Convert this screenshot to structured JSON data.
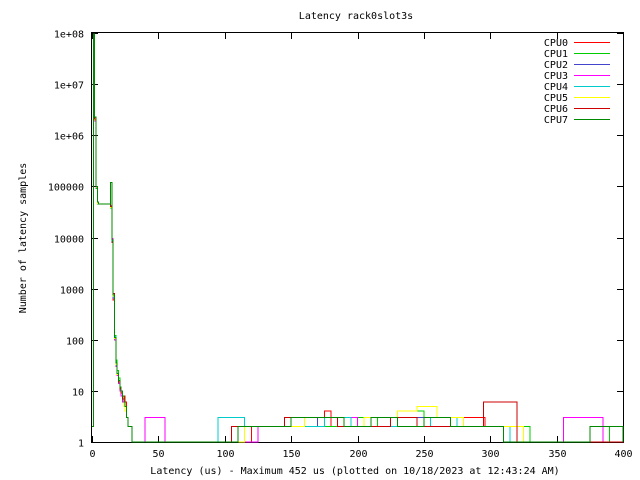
{
  "chart_data": {
    "type": "line",
    "title": "Latency rack0slot3s",
    "xlabel": "Latency (us) - Maximum 452 us (plotted on 10/18/2023 at 12:43:24 AM)",
    "ylabel": "Number of latency samples",
    "xlim": [
      0,
      400
    ],
    "ylim": [
      1,
      100000000
    ],
    "yscale": "log",
    "grid": false,
    "legend_position": "top-right",
    "x_ticks": [
      {
        "value": 0,
        "label": "0"
      },
      {
        "value": 50,
        "label": "50"
      },
      {
        "value": 100,
        "label": "100"
      },
      {
        "value": 150,
        "label": "150"
      },
      {
        "value": 200,
        "label": "200"
      },
      {
        "value": 250,
        "label": "250"
      },
      {
        "value": 300,
        "label": "300"
      },
      {
        "value": 350,
        "label": "350"
      },
      {
        "value": 400,
        "label": "400"
      }
    ],
    "y_ticks": [
      {
        "value": 1,
        "label": "1"
      },
      {
        "value": 10,
        "label": "10"
      },
      {
        "value": 100,
        "label": "100"
      },
      {
        "value": 1000,
        "label": "1000"
      },
      {
        "value": 10000,
        "label": "10000"
      },
      {
        "value": 100000,
        "label": "100000"
      },
      {
        "value": 1000000,
        "label": "1e+06"
      },
      {
        "value": 10000000,
        "label": "1e+07"
      },
      {
        "value": 100000000,
        "label": "1e+08"
      }
    ],
    "series": [
      {
        "name": "CPU0",
        "color": "#ff0000",
        "x": [
          0,
          1,
          2,
          3,
          4,
          5,
          6,
          7,
          8,
          9,
          10,
          11,
          12,
          13,
          14,
          15,
          16,
          17,
          18,
          19,
          20,
          21,
          22,
          23,
          24,
          25,
          26,
          27,
          30,
          40,
          60,
          80,
          100,
          120,
          140,
          160,
          175,
          180,
          195,
          210,
          240,
          270,
          296,
          320,
          360,
          400
        ],
        "y": [
          2,
          80000000,
          2000000,
          100000,
          50000,
          45000,
          45000,
          45000,
          45000,
          45000,
          45000,
          45000,
          45000,
          45000,
          40000,
          8000,
          600,
          100,
          30,
          20,
          15,
          12,
          10,
          8,
          8,
          6,
          3,
          2,
          1,
          1,
          1,
          1,
          1,
          2,
          2,
          3,
          4,
          2,
          3,
          2,
          2,
          3,
          2,
          1,
          1,
          1
        ]
      },
      {
        "name": "CPU1",
        "color": "#00cc00",
        "x": [
          0,
          1,
          2,
          3,
          4,
          5,
          6,
          7,
          8,
          9,
          10,
          11,
          12,
          13,
          14,
          15,
          16,
          17,
          18,
          19,
          20,
          21,
          22,
          23,
          24,
          25,
          26,
          27,
          30,
          45,
          60,
          80,
          100,
          125,
          150,
          170,
          190,
          215,
          230,
          250,
          280,
          300,
          330,
          360,
          390,
          400
        ],
        "y": [
          2,
          90000000,
          2200000,
          90000,
          45000,
          45000,
          45000,
          45000,
          45000,
          45000,
          45000,
          45000,
          45000,
          45000,
          38000,
          9000,
          700,
          120,
          40,
          25,
          18,
          12,
          9,
          7,
          6,
          5,
          3,
          2,
          1,
          1,
          1,
          1,
          1,
          2,
          3,
          2,
          3,
          2,
          4,
          3,
          2,
          2,
          1,
          1,
          2,
          1
        ]
      },
      {
        "name": "CPU2",
        "color": "#4444cc",
        "x": [
          0,
          1,
          2,
          3,
          4,
          5,
          6,
          7,
          8,
          9,
          10,
          11,
          12,
          13,
          14,
          15,
          16,
          17,
          18,
          19,
          20,
          21,
          22,
          23,
          24,
          25,
          26,
          27,
          30,
          50,
          70,
          90,
          110,
          130,
          150,
          170,
          190,
          210,
          230,
          250,
          270,
          290,
          310,
          340,
          370,
          400
        ],
        "y": [
          2,
          85000000,
          2100000,
          95000,
          48000,
          45000,
          45000,
          45000,
          45000,
          45000,
          45000,
          45000,
          45000,
          45000,
          42000,
          8500,
          650,
          110,
          35,
          22,
          16,
          11,
          9,
          7,
          5,
          4,
          3,
          2,
          1,
          1,
          1,
          1,
          2,
          2,
          2,
          3,
          2,
          2,
          3,
          2,
          2,
          2,
          1,
          1,
          1,
          1
        ]
      },
      {
        "name": "CPU3",
        "color": "#ff00ff",
        "x": [
          0,
          1,
          2,
          3,
          4,
          5,
          6,
          7,
          8,
          9,
          10,
          11,
          12,
          13,
          14,
          15,
          16,
          17,
          18,
          19,
          20,
          21,
          22,
          23,
          24,
          25,
          26,
          27,
          30,
          40,
          55,
          80,
          105,
          125,
          150,
          175,
          200,
          225,
          250,
          275,
          300,
          320,
          340,
          355,
          385,
          400
        ],
        "y": [
          2,
          80000000,
          1900000,
          95000,
          46000,
          45000,
          45000,
          45000,
          45000,
          45000,
          45000,
          45000,
          45000,
          45000,
          40000,
          9500,
          800,
          100,
          30,
          20,
          14,
          10,
          8,
          6,
          5,
          4,
          3,
          2,
          1,
          3,
          1,
          1,
          1,
          2,
          3,
          3,
          2,
          2,
          3,
          2,
          2,
          1,
          1,
          3,
          1,
          2
        ]
      },
      {
        "name": "CPU4",
        "color": "#00cccc",
        "x": [
          0,
          1,
          2,
          3,
          4,
          5,
          6,
          7,
          8,
          9,
          10,
          11,
          12,
          13,
          14,
          15,
          16,
          17,
          18,
          19,
          20,
          21,
          22,
          23,
          24,
          25,
          26,
          27,
          30,
          50,
          75,
          95,
          115,
          135,
          155,
          175,
          195,
          215,
          235,
          255,
          275,
          295,
          315,
          345,
          375,
          400
        ],
        "y": [
          2,
          88000000,
          2000000,
          100000,
          47000,
          45000,
          45000,
          45000,
          45000,
          45000,
          45000,
          45000,
          45000,
          45000,
          41000,
          8800,
          700,
          115,
          32,
          21,
          15,
          11,
          9,
          7,
          6,
          5,
          3,
          2,
          1,
          1,
          1,
          3,
          2,
          2,
          2,
          3,
          2,
          2,
          2,
          3,
          2,
          2,
          1,
          1,
          1,
          1
        ]
      },
      {
        "name": "CPU5",
        "color": "#ffff00",
        "x": [
          0,
          1,
          2,
          3,
          4,
          5,
          6,
          7,
          8,
          9,
          10,
          11,
          12,
          13,
          14,
          15,
          16,
          17,
          18,
          19,
          20,
          21,
          22,
          23,
          24,
          25,
          26,
          27,
          30,
          50,
          70,
          90,
          115,
          140,
          160,
          185,
          205,
          230,
          245,
          260,
          280,
          300,
          325,
          350,
          380,
          400
        ],
        "y": [
          2,
          82000000,
          2000000,
          98000,
          46000,
          45000,
          45000,
          45000,
          45000,
          45000,
          45000,
          45000,
          45000,
          45000,
          39000,
          9000,
          720,
          105,
          33,
          21,
          15,
          11,
          9,
          7,
          5,
          4,
          3,
          2,
          1,
          1,
          1,
          1,
          2,
          2,
          3,
          2,
          3,
          4,
          5,
          3,
          2,
          2,
          1,
          1,
          1,
          1
        ]
      },
      {
        "name": "CPU6",
        "color": "#cc0000",
        "x": [
          0,
          1,
          2,
          3,
          4,
          5,
          6,
          7,
          8,
          9,
          10,
          11,
          12,
          13,
          14,
          15,
          16,
          17,
          18,
          19,
          20,
          21,
          22,
          23,
          24,
          25,
          26,
          27,
          30,
          45,
          65,
          85,
          105,
          125,
          145,
          165,
          185,
          205,
          225,
          245,
          265,
          285,
          295,
          320,
          350,
          400
        ],
        "y": [
          2,
          86000000,
          2100000,
          100000,
          50000,
          45000,
          45000,
          45000,
          45000,
          45000,
          45000,
          45000,
          45000,
          45000,
          40000,
          9000,
          800,
          110,
          35,
          22,
          15,
          11,
          9,
          7,
          6,
          5,
          3,
          2,
          1,
          1,
          1,
          1,
          2,
          2,
          3,
          3,
          2,
          2,
          3,
          2,
          2,
          2,
          6,
          1,
          1,
          1
        ]
      },
      {
        "name": "CPU7",
        "color": "#008800",
        "x": [
          0,
          1,
          2,
          3,
          4,
          5,
          6,
          7,
          8,
          9,
          10,
          11,
          12,
          13,
          14,
          15,
          16,
          17,
          18,
          19,
          20,
          21,
          22,
          23,
          24,
          25,
          26,
          27,
          30,
          50,
          70,
          90,
          110,
          130,
          150,
          170,
          190,
          210,
          230,
          250,
          270,
          290,
          310,
          340,
          375,
          400
        ],
        "y": [
          2,
          95000000,
          2300000,
          100000,
          50000,
          45000,
          45000,
          45000,
          45000,
          45000,
          45000,
          45000,
          45000,
          45000,
          120000,
          9000,
          750,
          110,
          35,
          22,
          16,
          12,
          10,
          8,
          6,
          5,
          3,
          2,
          1,
          1,
          1,
          1,
          2,
          2,
          3,
          3,
          2,
          3,
          2,
          3,
          2,
          2,
          1,
          1,
          2,
          1
        ]
      }
    ]
  }
}
